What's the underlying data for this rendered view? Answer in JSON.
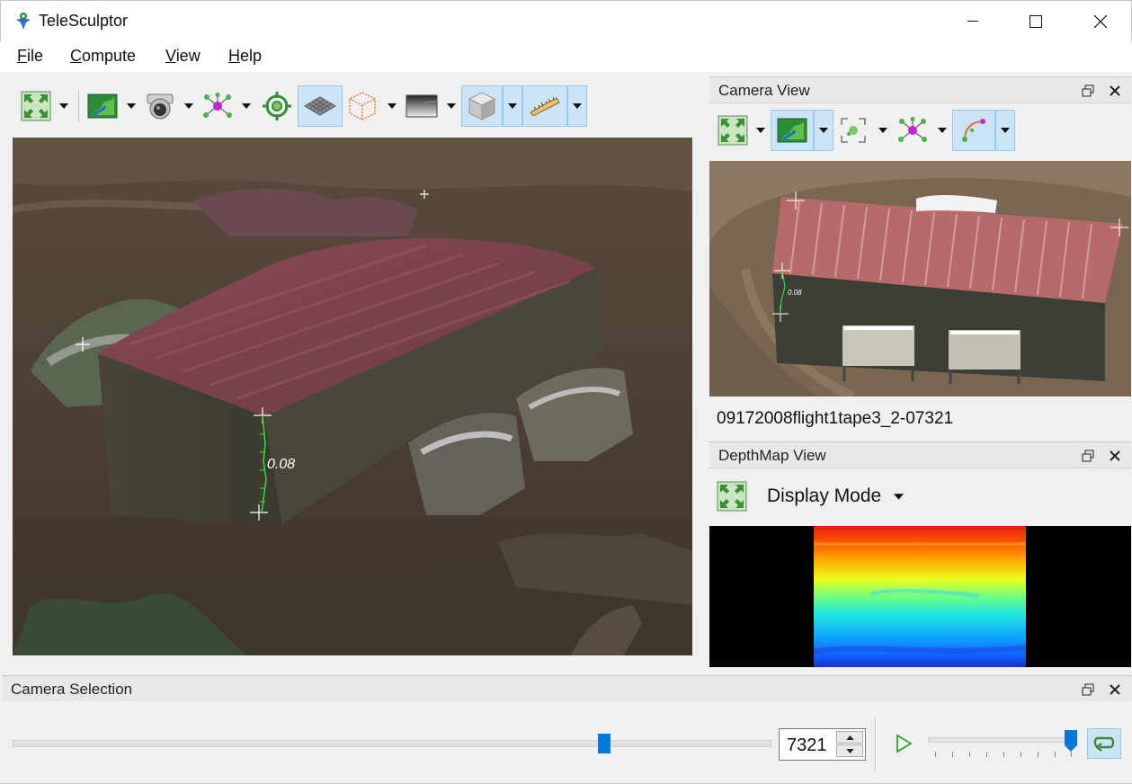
{
  "app": {
    "title": "TeleSculptor"
  },
  "menu": {
    "file": "File",
    "compute": "Compute",
    "view": "View",
    "help": "Help"
  },
  "world_view": {
    "measurement": "0.08"
  },
  "camera_view": {
    "title": "Camera View",
    "frame_name": "09172008flight1tape3_2-07321",
    "measurement": "0.08"
  },
  "depthmap_view": {
    "title": "DepthMap View",
    "display_mode": "Display Mode"
  },
  "camera_selection": {
    "title": "Camera Selection",
    "frame_value": "7321",
    "slider_fraction": 0.78,
    "speed_fraction": 0.98
  },
  "colors": {
    "accent": "#0078d7",
    "active_button_bg": "#cce4f7",
    "measure_line": "#33dd33"
  },
  "icons": {
    "reset_view": "reset-view-icon",
    "image_overlay": "image-icon",
    "camera": "camera-icon",
    "landmarks": "landmarks-icon",
    "target": "target-icon",
    "ground_plane": "grid-plane-icon",
    "roi_box": "roi-box-icon",
    "depth": "depth-icon",
    "mesh": "mesh-cube-icon",
    "ruler": "ruler-icon"
  }
}
